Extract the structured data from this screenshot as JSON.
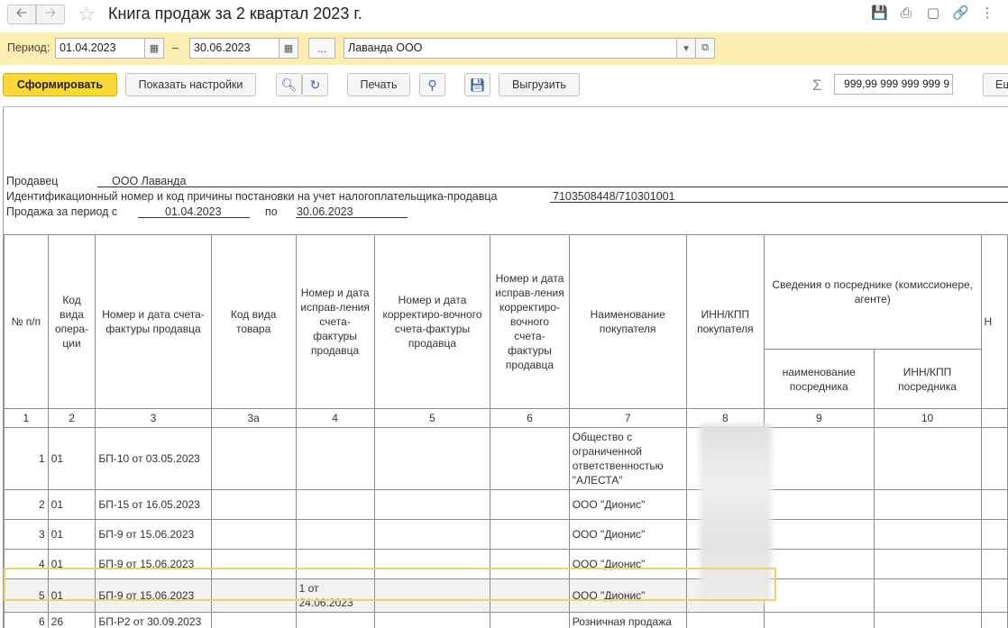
{
  "window": {
    "title": "Книга продаж за 2 квартал 2023 г.",
    "icons": [
      "save-icon",
      "print-icon",
      "preview-icon",
      "link-icon",
      "more-icon"
    ]
  },
  "period": {
    "label": "Период:",
    "from": "01.04.2023",
    "dash": "–",
    "to": "30.06.2023",
    "dots_label": "...",
    "organization": "Лаванда ООО"
  },
  "toolbar": {
    "generate_label": "Сформировать",
    "show_settings_label": "Показать настройки",
    "print_label": "Печать",
    "export_label": "Выгрузить",
    "sum_value": "9 999 999 999 999,99",
    "more_label": "Ещ"
  },
  "report": {
    "seller_label": "Продавец",
    "seller_value": "ООО Лаванда",
    "inn_label": "Идентификационный номер и код причины постановки на учет налогоплательщика-продавца",
    "inn_value": "7103508448/710301001",
    "period_label": "Продажа за период с",
    "period_from": "01.04.2023",
    "period_to_label": "по",
    "period_to": "30.06.2023",
    "columns": {
      "c1": "№ п/п",
      "c2": "Код вида опера-ции",
      "c3": "Номер и дата счета-фактуры продавца",
      "c3a": "Код вида товара",
      "c4": "Номер и дата исправ-ления счета-фактуры продавца",
      "c5": "Номер и дата корректиро-вочного счета-фактуры продавца",
      "c6": "Номер и дата исправ-ления корректиро-вочного счета-фактуры продавца",
      "c7": "Наименование покупателя",
      "c8": "ИНН/КПП покупателя",
      "c9_group": "Сведения о посреднике (комиссионере, агенте)",
      "c9": "наименование посредника",
      "c10": "ИНН/КПП посредника",
      "c11": "Н"
    },
    "numbers": [
      "1",
      "2",
      "3",
      "3а",
      "4",
      "5",
      "6",
      "7",
      "8",
      "9",
      "10"
    ],
    "rows": [
      {
        "n": "1",
        "code": "01",
        "invoice": "БП-10 от 03.05.2023",
        "fix": "",
        "buyer": "Общество с ограниченной ответственностью \"АЛЕСТА\""
      },
      {
        "n": "2",
        "code": "01",
        "invoice": "БП-15 от 16.05.2023",
        "fix": "",
        "buyer": "ООО \"Дионис\""
      },
      {
        "n": "3",
        "code": "01",
        "invoice": "БП-9 от 15.06.2023",
        "fix": "",
        "buyer": "ООО \"Дионис\""
      },
      {
        "n": "4",
        "code": "01",
        "invoice": "БП-9 от 15.06.2023",
        "fix": "",
        "buyer": "ООО \"Дионис\""
      },
      {
        "n": "5",
        "code": "01",
        "invoice": "БП-9 от 15.06.2023",
        "fix": "1 от 24.06.2023",
        "buyer": "ООО \"Дионис\""
      },
      {
        "n": "6",
        "code": "26",
        "invoice": "БП-Р2 от 30.09.2023",
        "fix": "",
        "buyer": "Розничная продажа"
      }
    ]
  }
}
